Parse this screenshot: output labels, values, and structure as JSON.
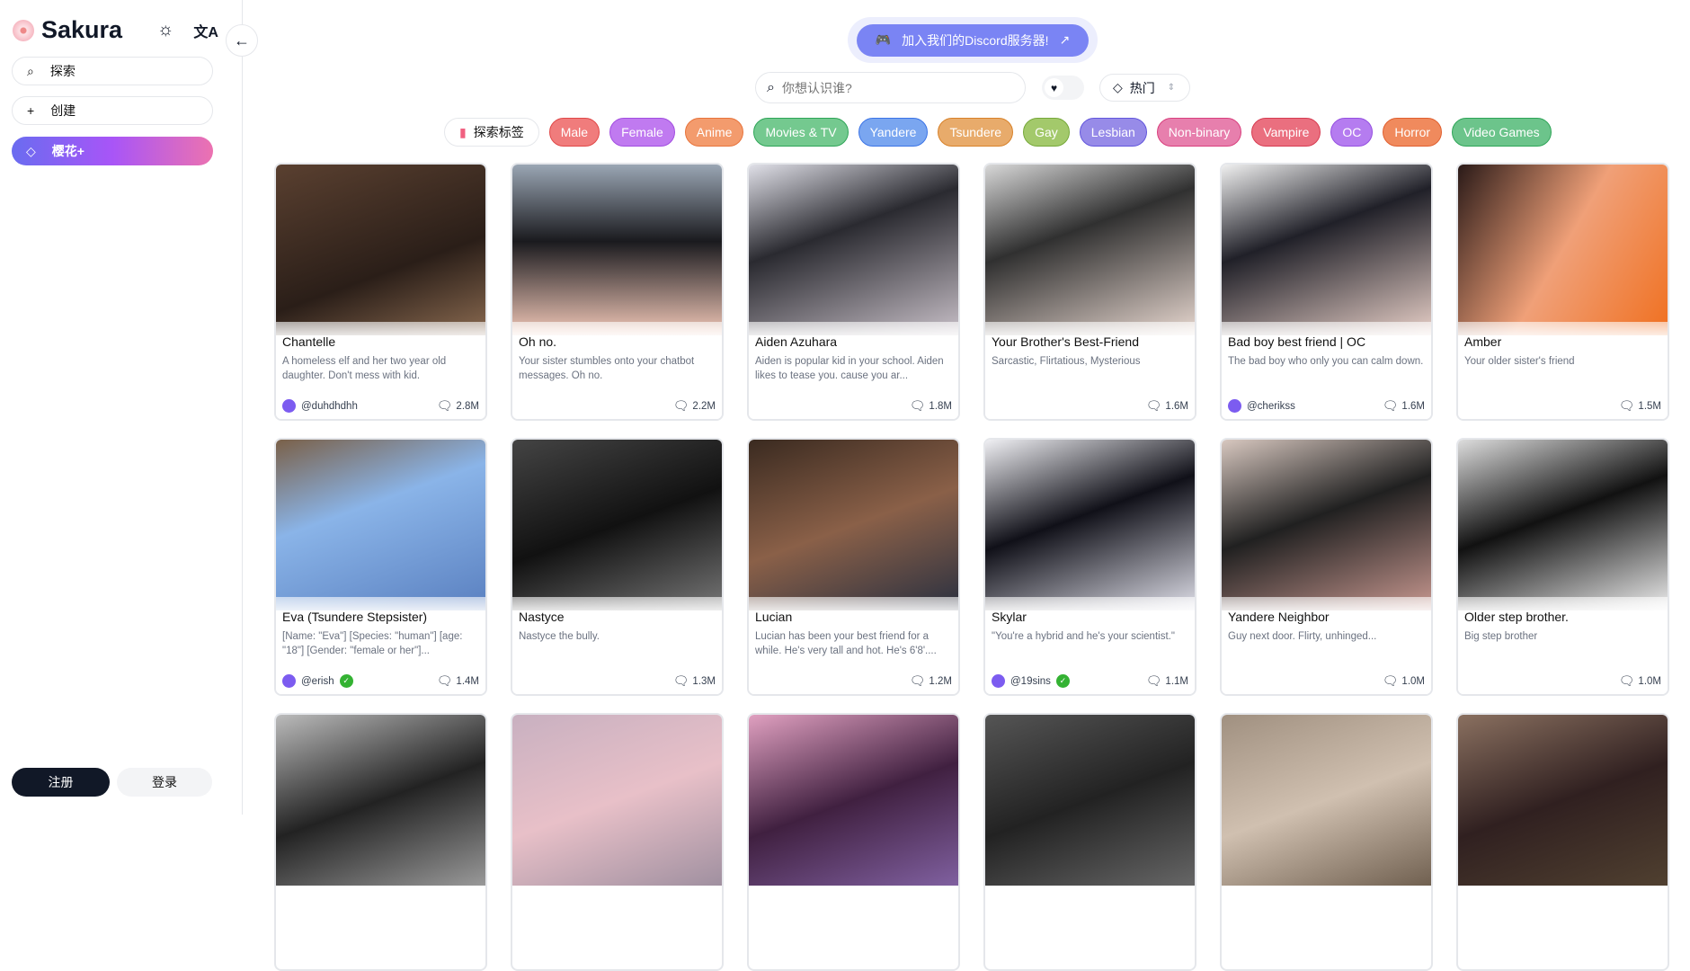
{
  "sidebar": {
    "brand": "Sakura",
    "nav": [
      {
        "label": "探索",
        "icon": "search-icon"
      },
      {
        "label": "创建",
        "icon": "plus-icon"
      },
      {
        "label": "樱花+",
        "icon": "diamond-icon"
      }
    ],
    "register": "注册",
    "login": "登录"
  },
  "header": {
    "discord": "加入我们的Discord服务器!",
    "search_placeholder": "你想认识谁?",
    "sort": "热门",
    "explore_tags": "探索标签"
  },
  "tags": [
    {
      "label": "Male",
      "bg": "#f07c7c",
      "bd": "#e04848"
    },
    {
      "label": "Female",
      "bg": "#c07af0",
      "bd": "#a24ee0"
    },
    {
      "label": "Anime",
      "bg": "#f39b6d",
      "bd": "#e8743c"
    },
    {
      "label": "Movies & TV",
      "bg": "#74c98f",
      "bd": "#2fa558"
    },
    {
      "label": "Yandere",
      "bg": "#7aa6f0",
      "bd": "#3b74e6"
    },
    {
      "label": "Tsundere",
      "bg": "#e8ab6b",
      "bd": "#d8822a"
    },
    {
      "label": "Gay",
      "bg": "#a3c96b",
      "bd": "#76a83a"
    },
    {
      "label": "Lesbian",
      "bg": "#978be8",
      "bd": "#6256dc"
    },
    {
      "label": "Non-binary",
      "bg": "#e77fad",
      "bd": "#d9407e"
    },
    {
      "label": "Vampire",
      "bg": "#ea6f7f",
      "bd": "#d63c52"
    },
    {
      "label": "OC",
      "bg": "#b57cf0",
      "bd": "#9550e0"
    },
    {
      "label": "Horror",
      "bg": "#f08a5d",
      "bd": "#e06030"
    },
    {
      "label": "Video Games",
      "bg": "#6cc48b",
      "bd": "#2fa558"
    }
  ],
  "cards": [
    {
      "title": "Chantelle",
      "desc": "A homeless elf and her two year old daughter. Don't mess with kid.",
      "author": "@duhdhdhh",
      "count": "2.8M",
      "img": "linear-gradient(160deg,#5a4030,#2a1e18 60%,#8a6a50)"
    },
    {
      "title": "Oh no.",
      "desc": "Your sister stumbles onto your chatbot messages. Oh no.",
      "author": "",
      "count": "2.2M",
      "img": "linear-gradient(180deg,#9aa6b4,#1a1a1e 45%,#f2c8b8)"
    },
    {
      "title": "Aiden Azuhara",
      "desc": "Aiden is popular kid in your school. Aiden likes to tease you. cause you ar...",
      "author": "",
      "count": "1.8M",
      "img": "linear-gradient(160deg,#e0e0e8,#2a2a30 40%,#c8c0c8)"
    },
    {
      "title": "Your Brother's Best-Friend",
      "desc": "Sarcastic, Flirtatious, Mysterious",
      "author": "",
      "count": "1.6M",
      "img": "linear-gradient(160deg,#d8d8d8,#303030 40%,#e8d8d0)"
    },
    {
      "title": "Bad boy best friend | OC",
      "desc": "The bad boy who only you can calm down.",
      "author": "@cherikss",
      "count": "1.6M",
      "img": "linear-gradient(160deg,#f0f0f0,#202028 40%,#e8d0c8)"
    },
    {
      "title": "Amber",
      "desc": "Your older sister's friend",
      "author": "",
      "count": "1.5M",
      "img": "linear-gradient(120deg,#2a1a18,#f0a078 50%,#f07020)"
    },
    {
      "title": "Eva (Tsundere Stepsister)",
      "desc": "[Name: \"Eva\"] [Species: \"human\"] [age: \"18\"] [Gender: \"female or her\"]...",
      "author": "@erish",
      "count": "1.4M",
      "img": "linear-gradient(160deg,#7a6048,#8ab4e8 40%,#5a80c0)"
    },
    {
      "title": "Nastyce",
      "desc": "Nastyce the bully.",
      "author": "",
      "count": "1.3M",
      "img": "linear-gradient(160deg,#444,#111 50%,#777)"
    },
    {
      "title": "Lucian",
      "desc": "Lucian has been your best friend for a while. He's very tall and hot. He's 6'8'....",
      "author": "",
      "count": "1.2M",
      "img": "linear-gradient(160deg,#3a2a20,#8a6048 50%,#2a3040)"
    },
    {
      "title": "Skylar",
      "desc": "\"You're a hybrid and he's your scientist.\"",
      "author": "@19sins",
      "count": "1.1M",
      "img": "linear-gradient(160deg,#f0f0f4,#101018 45%,#e0e0ea)"
    },
    {
      "title": "Yandere Neighbor",
      "desc": "Guy next door. Flirty, unhinged...",
      "author": "",
      "count": "1.0M",
      "img": "linear-gradient(160deg,#d8c8c0,#202020 45%,#c89890)"
    },
    {
      "title": "Older step brother.",
      "desc": "Big step brother",
      "author": "",
      "count": "1.0M",
      "img": "linear-gradient(160deg,#ddd,#111 45%,#eee)"
    },
    {
      "title": "",
      "desc": "",
      "author": "",
      "count": "",
      "img": "linear-gradient(160deg,#bbb,#222 50%,#999)"
    },
    {
      "title": "",
      "desc": "",
      "author": "",
      "count": "",
      "img": "linear-gradient(160deg,#c8b0c0,#e8c0c8 50%,#a090a0)"
    },
    {
      "title": "",
      "desc": "",
      "author": "",
      "count": "",
      "img": "linear-gradient(160deg,#e0a0c0,#402040 50%,#8060a0)"
    },
    {
      "title": "",
      "desc": "",
      "author": "",
      "count": "",
      "img": "linear-gradient(160deg,#555,#222 50%,#666)"
    },
    {
      "title": "",
      "desc": "",
      "author": "",
      "count": "",
      "img": "linear-gradient(160deg,#a09080,#d0c0b0 50%,#706050)"
    },
    {
      "title": "",
      "desc": "",
      "author": "",
      "count": "",
      "img": "linear-gradient(160deg,#8a7060,#302020 50%,#504030)"
    }
  ]
}
